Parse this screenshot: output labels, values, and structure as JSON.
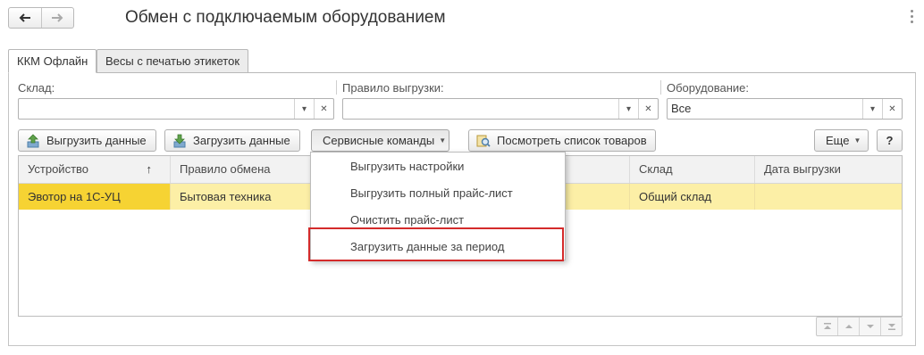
{
  "window": {
    "title": "Обмен с подключаемым оборудованием"
  },
  "tabs": [
    {
      "label": "ККМ Офлайн",
      "active": true
    },
    {
      "label": "Весы с печатью этикеток",
      "active": false
    }
  ],
  "filters": {
    "warehouse": {
      "label": "Склад:",
      "value": ""
    },
    "rule": {
      "label": "Правило выгрузки:",
      "value": ""
    },
    "equipment": {
      "label": "Оборудование:",
      "value": "Все"
    }
  },
  "toolbar": {
    "upload_label": "Выгрузить данные",
    "download_label": "Загрузить данные",
    "service_label": "Сервисные команды",
    "view_products_label": "Посмотреть список товаров",
    "more_label": "Еще",
    "help_label": "?"
  },
  "table": {
    "columns": [
      "Устройство",
      "Правило обмена",
      "",
      "Склад",
      "Дата выгрузки"
    ],
    "sort_indicator": "↑",
    "rows": [
      {
        "device": "Эвотор на 1С-УЦ",
        "rule": "Бытовая техника",
        "middle": "",
        "warehouse": "Общий склад",
        "date": ""
      }
    ]
  },
  "service_menu": {
    "items": [
      "Выгрузить настройки",
      "Выгрузить полный прайс-лист",
      "Очистить прайс-лист",
      "Загрузить данные за период"
    ]
  },
  "colors": {
    "selected_row": "#fcefa6",
    "selected_cell": "#f6d333",
    "highlight_frame": "#d42b2b"
  }
}
